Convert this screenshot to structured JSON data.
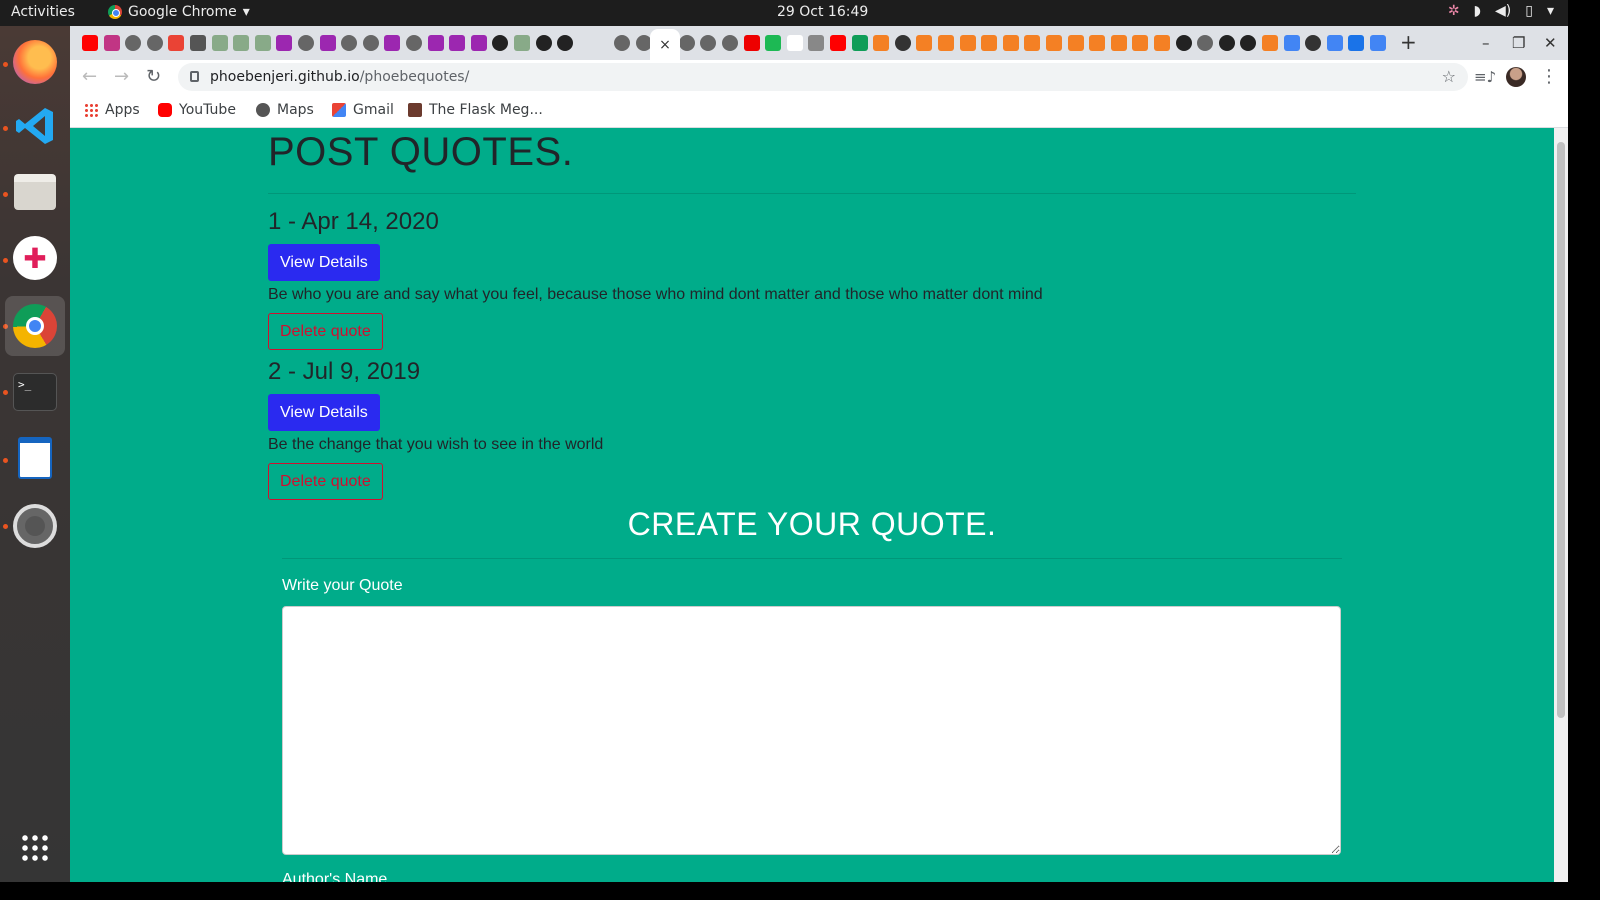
{
  "topbar": {
    "activities": "Activities",
    "app_name": "Google Chrome",
    "clock": "29 Oct  16:49"
  },
  "browser": {
    "active_tab_close": "×",
    "new_tab": "+",
    "url_host": "phoebenjeri.github.io",
    "url_path": "/phoebequotes/",
    "bookmarks": [
      {
        "label": "Apps",
        "icon": "apps-grid-icon"
      },
      {
        "label": "YouTube",
        "icon": "youtube-icon"
      },
      {
        "label": "Maps",
        "icon": "maps-icon"
      },
      {
        "label": "Gmail",
        "icon": "gmail-icon"
      },
      {
        "label": "The Flask Meg...",
        "icon": "flask-mega-icon"
      }
    ]
  },
  "dock": {
    "apps": [
      "firefox",
      "vscode",
      "files",
      "slack",
      "chrome",
      "terminal",
      "writer",
      "settings",
      "show-apps"
    ]
  },
  "page": {
    "title": "POST QUOTES.",
    "quotes": [
      {
        "heading": "1 - Apr 14, 2020",
        "details_label": "View Details",
        "text": "Be who you are and say what you feel, because those who mind dont matter and those who matter dont mind",
        "delete_label": "Delete quote"
      },
      {
        "heading": "2 - Jul 9, 2019",
        "details_label": "View Details",
        "text": "Be the change that you wish to see in the world",
        "delete_label": "Delete quote"
      }
    ],
    "create": {
      "title": "CREATE YOUR QUOTE.",
      "quote_label": "Write your Quote",
      "quote_value": "",
      "author_label": "Author's Name"
    }
  },
  "colors": {
    "page_bg": "#00ac8a",
    "primary_button": "#2a2af0",
    "danger": "#d01030"
  }
}
